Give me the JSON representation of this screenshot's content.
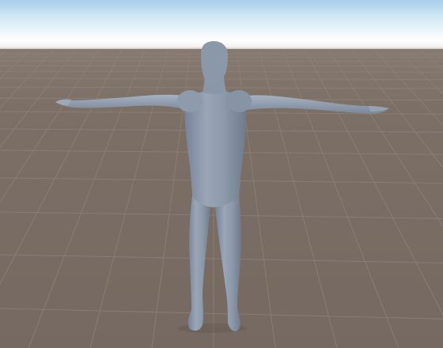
{
  "scene": {
    "colors": {
      "sky_top": "#a8cde8",
      "horizon": "#ffffff",
      "ground": "#776a62",
      "grid_line": "#8f8379",
      "figure": "#8a97a8",
      "figure_shadow": "#6f7b8b",
      "figure_highlight": "#a4b0bf"
    },
    "grid": {
      "visible": true
    },
    "model": {
      "pose": "T-pose",
      "icon": "humanoid-mannequin"
    }
  }
}
